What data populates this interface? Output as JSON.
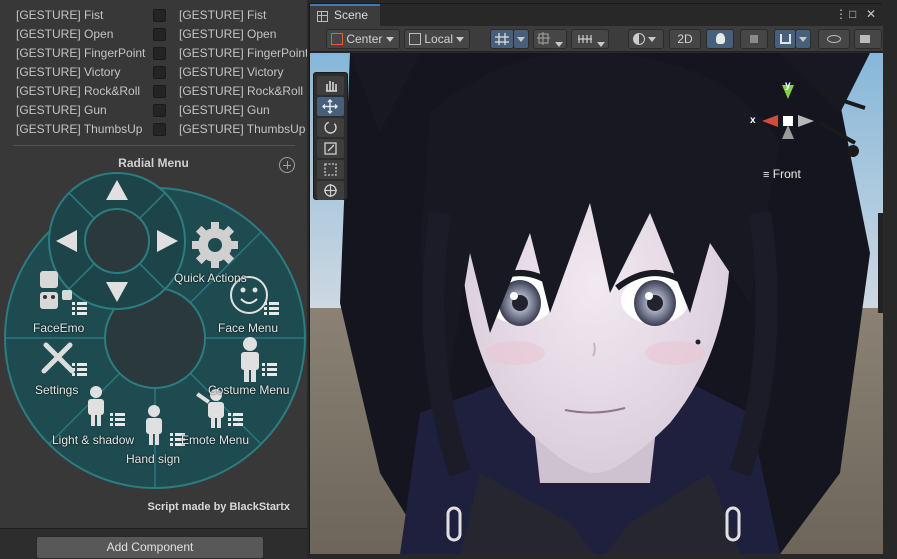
{
  "inspector": {
    "gestures_left": [
      "[GESTURE] Fist",
      "[GESTURE] Open",
      "[GESTURE] FingerPoint",
      "[GESTURE] Victory",
      "[GESTURE] Rock&Roll",
      "[GESTURE] Gun",
      "[GESTURE] ThumbsUp"
    ],
    "gestures_right": [
      "[GESTURE] Fist",
      "[GESTURE] Open",
      "[GESTURE] FingerPoint",
      "[GESTURE] Victory",
      "[GESTURE] Rock&Roll",
      "[GESTURE] Gun",
      "[GESTURE] ThumbsUp"
    ],
    "radial_menu_title": "Radial Menu",
    "add_icon": "plus-circle-icon",
    "radial_items": {
      "quick_actions": "Quick Actions",
      "faceemo": "FaceEmo",
      "face_menu": "Face Menu",
      "settings": "Settings",
      "costume_menu": "Costume Menu",
      "light_shadow": "Light & shadow",
      "emote_menu": "Emote Menu",
      "hand_sign": "Hand sign"
    },
    "credit": "Script made by BlackStartx",
    "add_component": "Add Component"
  },
  "scene": {
    "tab_label": "Scene",
    "window_controls": [
      "⋮",
      "□",
      "✕"
    ],
    "toolbar": {
      "pivot": "Center",
      "space": "Local",
      "mode_2d": "2D"
    },
    "gizmo": {
      "y_label": "y",
      "x_label": "x",
      "view_label": "Front"
    }
  },
  "colors": {
    "accent_blue": "#3a79bb",
    "radial_teal": "#2c7d82",
    "gizmo_y": "#7fd14b",
    "gizmo_x": "#d24b3c"
  }
}
